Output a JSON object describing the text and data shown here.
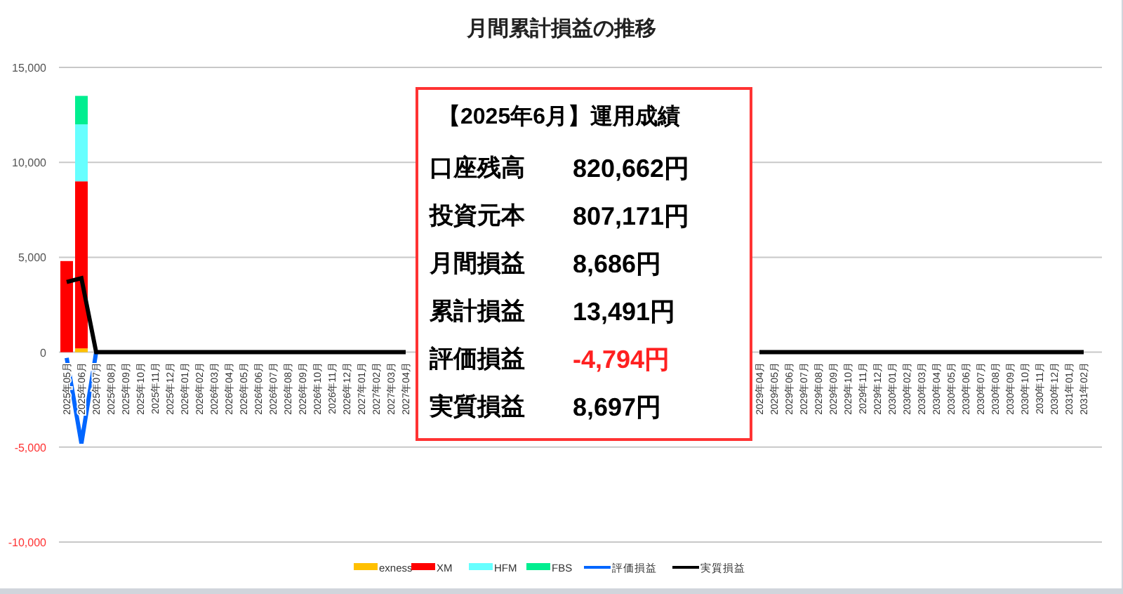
{
  "chart": {
    "title": "月間累計損益の推移",
    "chart_data": {
      "type": "bar",
      "stacked": true,
      "grid": true,
      "legend": true,
      "categories": [
        "2025年05月",
        "2025年06月",
        "2025年07月",
        "2025年08月",
        "2025年09月",
        "2025年10月",
        "2025年11月",
        "2025年12月",
        "2026年01月",
        "2026年02月",
        "2026年03月",
        "2026年04月",
        "2026年05月",
        "2026年06月",
        "2026年07月",
        "2026年08月",
        "2026年09月",
        "2026年10月",
        "2026年11月",
        "2026年12月",
        "2027年01月",
        "2027年02月",
        "2027年03月",
        "2027年04月",
        null,
        null,
        null,
        null,
        null,
        null,
        null,
        null,
        null,
        null,
        null,
        null,
        null,
        null,
        null,
        null,
        null,
        null,
        null,
        null,
        null,
        null,
        null,
        "2029年04月",
        "2029年05月",
        "2029年06月",
        "2029年07月",
        "2029年08月",
        "2029年09月",
        "2029年10月",
        "2029年11月",
        "2029年12月",
        "2030年01月",
        "2030年02月",
        "2030年03月",
        "2030年04月",
        "2030年05月",
        "2030年06月",
        "2030年07月",
        "2030年08月",
        "2030年09月",
        "2030年10月",
        "2030年11月",
        "2030年12月",
        "2031年01月",
        "2031年02月"
      ],
      "series": [
        {
          "name": "exness",
          "type": "bar",
          "color": "#ffc000",
          "values": [
            null,
            200,
            null,
            null,
            null,
            null,
            null,
            null,
            null,
            null,
            null,
            null,
            null,
            null,
            null,
            null,
            null,
            null,
            null,
            null,
            null,
            null,
            null,
            null,
            null,
            null,
            null,
            null,
            null,
            null,
            null,
            null,
            null,
            null,
            null,
            null,
            null,
            null,
            null,
            null,
            null,
            null,
            null,
            null,
            null,
            null,
            null,
            null,
            null,
            null,
            null,
            null,
            null,
            null,
            null,
            null,
            null,
            null,
            null,
            null,
            null,
            null,
            null,
            null,
            null,
            null,
            null,
            null,
            null,
            null
          ]
        },
        {
          "name": "XM",
          "type": "bar",
          "color": "#ff0000",
          "values": [
            4800,
            8800,
            null,
            null,
            null,
            null,
            null,
            null,
            null,
            null,
            null,
            null,
            null,
            null,
            null,
            null,
            null,
            null,
            null,
            null,
            null,
            null,
            null,
            null,
            null,
            null,
            null,
            null,
            null,
            null,
            null,
            null,
            null,
            null,
            null,
            null,
            null,
            null,
            null,
            null,
            null,
            null,
            null,
            null,
            null,
            null,
            null,
            null,
            null,
            null,
            null,
            null,
            null,
            null,
            null,
            null,
            null,
            null,
            null,
            null,
            null,
            null,
            null,
            null,
            null,
            null,
            null,
            null,
            null,
            null
          ]
        },
        {
          "name": "HFM",
          "type": "bar",
          "color": "#66ffff",
          "values": [
            null,
            3000,
            null,
            null,
            null,
            null,
            null,
            null,
            null,
            null,
            null,
            null,
            null,
            null,
            null,
            null,
            null,
            null,
            null,
            null,
            null,
            null,
            null,
            null,
            null,
            null,
            null,
            null,
            null,
            null,
            null,
            null,
            null,
            null,
            null,
            null,
            null,
            null,
            null,
            null,
            null,
            null,
            null,
            null,
            null,
            null,
            null,
            null,
            null,
            null,
            null,
            null,
            null,
            null,
            null,
            null,
            null,
            null,
            null,
            null,
            null,
            null,
            null,
            null,
            null,
            null,
            null,
            null,
            null,
            null
          ]
        },
        {
          "name": "FBS",
          "type": "bar",
          "color": "#00ee90",
          "values": [
            null,
            1500,
            null,
            null,
            null,
            null,
            null,
            null,
            null,
            null,
            null,
            null,
            null,
            null,
            null,
            null,
            null,
            null,
            null,
            null,
            null,
            null,
            null,
            null,
            null,
            null,
            null,
            null,
            null,
            null,
            null,
            null,
            null,
            null,
            null,
            null,
            null,
            null,
            null,
            null,
            null,
            null,
            null,
            null,
            null,
            null,
            null,
            null,
            null,
            null,
            null,
            null,
            null,
            null,
            null,
            null,
            null,
            null,
            null,
            null,
            null,
            null,
            null,
            null,
            null,
            null,
            null,
            null,
            null,
            null
          ]
        },
        {
          "name": "評価損益",
          "type": "line",
          "color": "#0066ff",
          "values": [
            -300,
            -4800,
            0,
            null,
            null,
            null,
            null,
            null,
            null,
            null,
            null,
            null,
            null,
            null,
            null,
            null,
            null,
            null,
            null,
            null,
            null,
            null,
            null,
            null,
            null,
            null,
            null,
            null,
            null,
            null,
            null,
            null,
            null,
            null,
            null,
            null,
            null,
            null,
            null,
            null,
            null,
            null,
            null,
            null,
            null,
            null,
            null,
            null,
            null,
            null,
            null,
            null,
            null,
            null,
            null,
            null,
            null,
            null,
            null,
            null,
            null,
            null,
            null,
            null,
            null,
            null,
            null,
            null,
            null,
            null
          ]
        },
        {
          "name": "実質損益",
          "type": "line",
          "color": "#000000",
          "values": [
            3700,
            3900,
            0,
            0,
            0,
            0,
            0,
            0,
            0,
            0,
            0,
            0,
            0,
            0,
            0,
            0,
            0,
            0,
            0,
            0,
            0,
            0,
            0,
            0,
            null,
            null,
            null,
            null,
            null,
            null,
            null,
            null,
            null,
            null,
            null,
            null,
            null,
            null,
            null,
            null,
            null,
            null,
            null,
            null,
            null,
            null,
            null,
            0,
            0,
            0,
            0,
            0,
            0,
            0,
            0,
            0,
            0,
            0,
            0,
            0,
            0,
            0,
            0,
            0,
            0,
            0,
            0,
            0,
            0,
            0
          ]
        }
      ],
      "ylim": [
        -10000,
        15000
      ],
      "yticks": [
        {
          "value": 15000,
          "label": "15,000"
        },
        {
          "value": 10000,
          "label": "10,000"
        },
        {
          "value": 5000,
          "label": "5,000"
        },
        {
          "value": 0,
          "label": "0"
        },
        {
          "value": -5000,
          "label": "-5,000"
        },
        {
          "value": -10000,
          "label": "-10,000"
        }
      ]
    }
  },
  "summary": {
    "heading": "【2025年6月】運用成績",
    "rows": [
      {
        "label": "口座残高",
        "value": "820,662円",
        "negative": false
      },
      {
        "label": "投資元本",
        "value": "807,171円",
        "negative": false
      },
      {
        "label": "月間損益",
        "value": "8,686円",
        "negative": false
      },
      {
        "label": "累計損益",
        "value": "13,491円",
        "negative": false
      },
      {
        "label": "評価損益",
        "value": "-4,794円",
        "negative": true
      },
      {
        "label": "実質損益",
        "value": "8,697円",
        "negative": false
      }
    ]
  }
}
